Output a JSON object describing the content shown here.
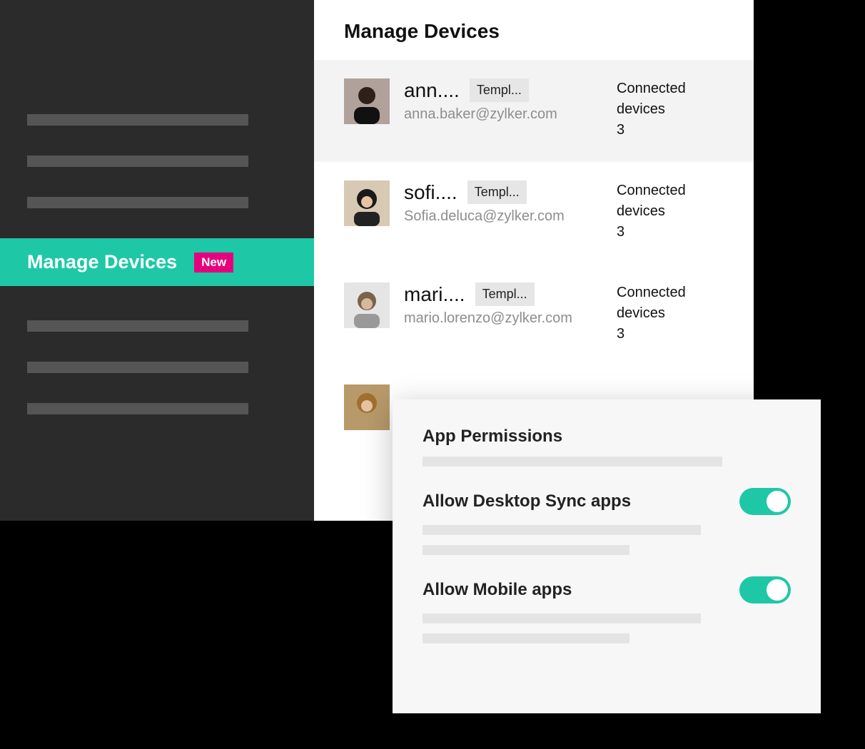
{
  "sidebar": {
    "activeItem": {
      "label": "Manage Devices",
      "badge": "New"
    }
  },
  "main": {
    "title": "Manage Devices",
    "devicesLabel": "Connected devices",
    "users": [
      {
        "name": "ann....",
        "tag": "Templ...",
        "email": "anna.baker@zylker.com",
        "devices": "3"
      },
      {
        "name": "sofi....",
        "tag": "Templ...",
        "email": "Sofia.deluca@zylker.com",
        "devices": "3"
      },
      {
        "name": "mari....",
        "tag": "Templ...",
        "email": "mario.lorenzo@zylker.com",
        "devices": "3"
      }
    ]
  },
  "permissions": {
    "title": "App Permissions",
    "items": [
      {
        "label": "Allow Desktop Sync apps",
        "enabled": true
      },
      {
        "label": "Allow Mobile apps",
        "enabled": true
      }
    ]
  }
}
